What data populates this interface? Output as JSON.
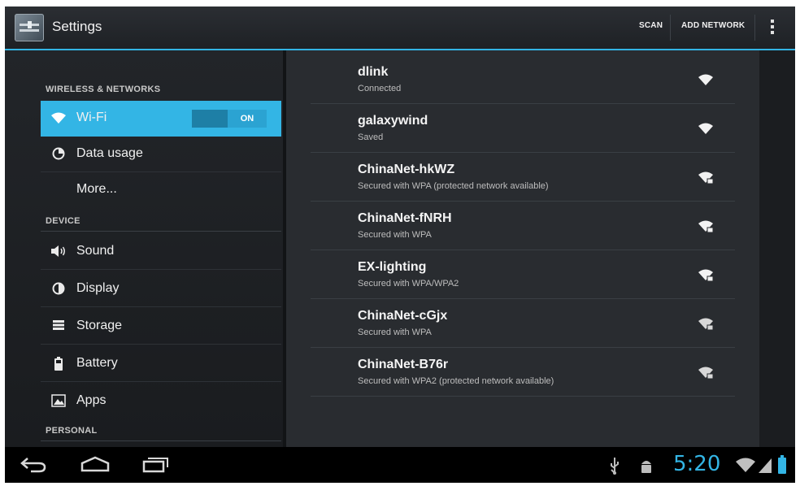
{
  "app": {
    "title": "Settings"
  },
  "actionbar": {
    "scan_label": "SCAN",
    "add_network_label": "ADD NETWORK"
  },
  "sidebar": {
    "sections": [
      {
        "label": "WIRELESS & NETWORKS"
      },
      {
        "label": "DEVICE"
      },
      {
        "label": "PERSONAL"
      }
    ],
    "items": [
      {
        "label": "Wi-Fi",
        "icon": "wifi-icon",
        "selected": true
      },
      {
        "label": "Data usage",
        "icon": "data-usage-icon"
      },
      {
        "label": "More..."
      },
      {
        "label": "Sound",
        "icon": "sound-icon"
      },
      {
        "label": "Display",
        "icon": "display-icon"
      },
      {
        "label": "Storage",
        "icon": "storage-icon"
      },
      {
        "label": "Battery",
        "icon": "battery-icon"
      },
      {
        "label": "Apps",
        "icon": "apps-icon"
      }
    ],
    "wifi_toggle": {
      "state": "ON"
    }
  },
  "networks": [
    {
      "name": "dlink",
      "status": "Connected",
      "secured": false
    },
    {
      "name": "galaxywind",
      "status": "Saved",
      "secured": false
    },
    {
      "name": "ChinaNet-hkWZ",
      "status": "Secured with WPA (protected network available)",
      "secured": true
    },
    {
      "name": "ChinaNet-fNRH",
      "status": "Secured with WPA",
      "secured": true
    },
    {
      "name": "EX-lighting",
      "status": "Secured with WPA/WPA2",
      "secured": true
    },
    {
      "name": "ChinaNet-cGjx",
      "status": "Secured with WPA",
      "secured": true
    },
    {
      "name": "ChinaNet-B76r",
      "status": "Secured with WPA2 (protected network available)",
      "secured": true
    }
  ],
  "statusbar": {
    "time": "5:20"
  },
  "colors": {
    "accent": "#33b5e5",
    "background": "#292c30",
    "navbar": "#000000"
  }
}
